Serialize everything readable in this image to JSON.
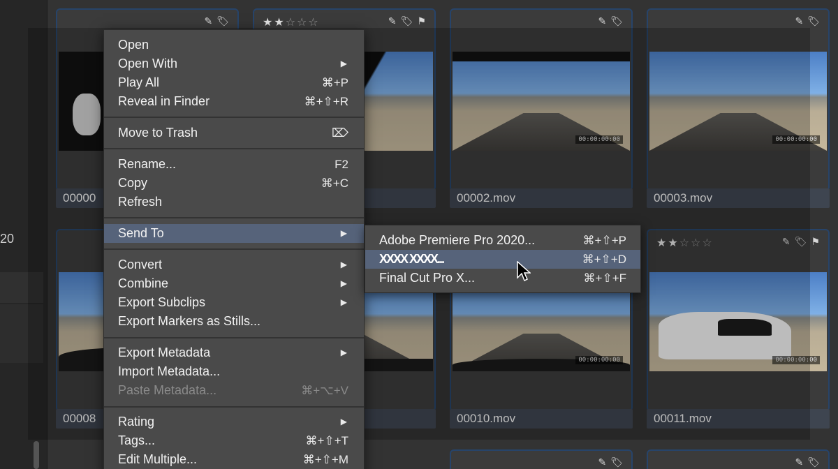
{
  "left_panel": {
    "number": "20"
  },
  "tiles": [
    {
      "name": "00000",
      "stars": 0,
      "badges": [
        "pencil-icon",
        "tag-icon"
      ],
      "timecode": ""
    },
    {
      "name": "",
      "stars": 2,
      "badges": [
        "pencil-icon",
        "tag-icon",
        "flag-icon"
      ],
      "timecode": ""
    },
    {
      "name": "00002.mov",
      "stars": 0,
      "badges": [
        "pencil-icon",
        "tag-icon"
      ],
      "timecode": "00:00:00:00"
    },
    {
      "name": "00003.mov",
      "stars": 0,
      "badges": [
        "pencil-icon",
        "tag-icon"
      ],
      "timecode": "00:00:00:00"
    },
    {
      "name": "00008",
      "stars": 0,
      "badges": [],
      "timecode": ""
    },
    {
      "name": "",
      "stars": 0,
      "badges": [],
      "timecode": ""
    },
    {
      "name": "00010.mov",
      "stars": 0,
      "badges": [],
      "timecode": "00:00:00:00"
    },
    {
      "name": "00011.mov",
      "stars": 2,
      "badges": [
        "pencil-icon",
        "tag-icon",
        "flag-icon"
      ],
      "timecode": "00:00:00:00"
    }
  ],
  "context_menu": {
    "items": [
      {
        "label": "Open",
        "shortcut": "",
        "submenu": false
      },
      {
        "label": "Open With",
        "shortcut": "",
        "submenu": true
      },
      {
        "label": "Play All",
        "shortcut": "⌘+P",
        "submenu": false
      },
      {
        "label": "Reveal in Finder",
        "shortcut": "⌘+⇧+R",
        "submenu": false
      },
      {
        "label": "Move to Trash",
        "shortcut": "⌦",
        "submenu": false
      },
      {
        "label": "Rename...",
        "shortcut": "F2",
        "submenu": false
      },
      {
        "label": "Copy",
        "shortcut": "⌘+C",
        "submenu": false
      },
      {
        "label": "Refresh",
        "shortcut": "",
        "submenu": false
      },
      {
        "label": "Send To",
        "shortcut": "",
        "submenu": true,
        "highlighted": true
      },
      {
        "label": "Convert",
        "shortcut": "",
        "submenu": true
      },
      {
        "label": "Combine",
        "shortcut": "",
        "submenu": true
      },
      {
        "label": "Export Subclips",
        "shortcut": "",
        "submenu": true
      },
      {
        "label": "Export Markers as Stills...",
        "shortcut": "",
        "submenu": false
      },
      {
        "label": "Export Metadata",
        "shortcut": "",
        "submenu": true
      },
      {
        "label": "Import Metadata...",
        "shortcut": "",
        "submenu": false
      },
      {
        "label": "Paste Metadata...",
        "shortcut": "⌘+⌥+V",
        "submenu": false,
        "disabled": true
      },
      {
        "label": "Rating",
        "shortcut": "",
        "submenu": true
      },
      {
        "label": "Tags...",
        "shortcut": "⌘+⇧+T",
        "submenu": false
      },
      {
        "label": "Edit Multiple...",
        "shortcut": "⌘+⇧+M",
        "submenu": false
      }
    ]
  },
  "submenu": {
    "items": [
      {
        "label": "Adobe Premiere Pro 2020...",
        "shortcut": "⌘+⇧+P"
      },
      {
        "label": "XXXX XXXX...",
        "shortcut": "⌘+⇧+D",
        "highlighted": true
      },
      {
        "label": "Final Cut Pro X...",
        "shortcut": "⌘+⇧+F"
      }
    ]
  },
  "colors": {
    "menu_bg": "#4a4a4a",
    "highlight": "#56637a",
    "tile_border": "#27446a"
  }
}
